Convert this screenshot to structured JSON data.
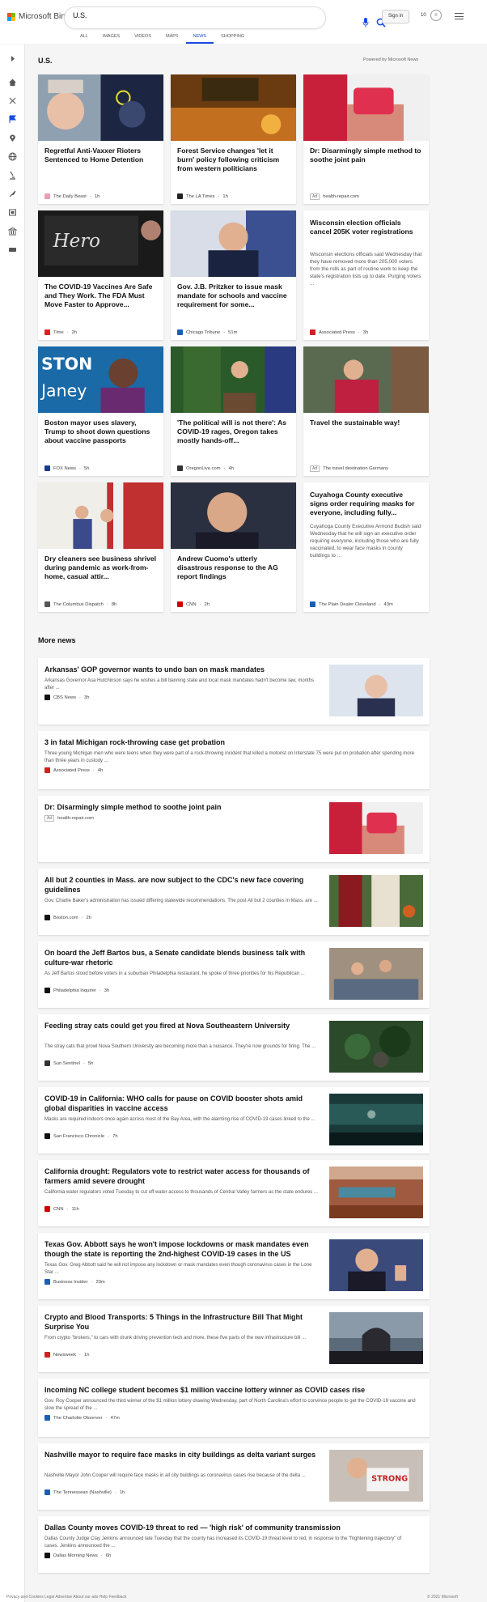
{
  "header": {
    "brand": "Microsoft Bing",
    "search_value": "U.S.",
    "signin_label": "Sign in",
    "points": "10",
    "scopes": [
      "ALL",
      "IMAGES",
      "VIDEOS",
      "MAPS",
      "NEWS",
      "SHOPPING"
    ],
    "active_scope": "NEWS"
  },
  "section": {
    "title": "U.S.",
    "powered_by": "Powered by Microsoft News"
  },
  "cards": [
    {
      "title": "Regretful Anti-Vaxxer Rioters Sentenced to Home Detention",
      "source": "The Daily Beast",
      "time": "1h",
      "favcolor": "#e8a0b0",
      "img": "riot"
    },
    {
      "title": "Forest Service changes 'let it burn' policy following criticism from western politicians",
      "source": "The LA Times",
      "time": "1h",
      "favcolor": "#222",
      "img": "fire"
    },
    {
      "title": "Dr: Disarmingly simple method to soothe joint pain",
      "source": "health-repair.com",
      "ad": "Ad",
      "img": "gummy"
    },
    {
      "title": "The COVID-19 Vaccines Are Safe and They Work. The FDA Must Move Faster to Approve...",
      "source": "Time",
      "time": "2h",
      "favcolor": "#e02020",
      "img": "vaccine"
    },
    {
      "title": "Gov. J.B. Pritzker to issue mask mandate for schools and vaccine requirement for some...",
      "source": "Chicago Tribune",
      "time": "51m",
      "favcolor": "#1a5fb4",
      "img": "pritzker"
    },
    {
      "title": "Wisconsin election officials cancel 205K voter registrations",
      "desc": "Wisconsin elections officials said Wednesday that they have removed more than 205,000 voters from the rolls as part of routine work to keep the state's registration lists up to date. Purging voters ...",
      "source": "Associated Press",
      "time": "3h",
      "favcolor": "#d02020",
      "img": ""
    },
    {
      "title": "Boston mayor uses slavery, Trump to shoot down questions about vaccine passports",
      "source": "FOX News",
      "time": "5h",
      "favcolor": "#1a3a8a",
      "img": "janey"
    },
    {
      "title": "'The political will is not there': As COVID-19 rages, Oregon takes mostly hands-off...",
      "source": "OregonLive.com",
      "time": "4h",
      "favcolor": "#333",
      "img": "oregon"
    },
    {
      "title": "Travel the sustainable way!",
      "source": "The travel destination Germany",
      "ad": "Ad",
      "img": "travel"
    },
    {
      "title": "Dry cleaners see business shrivel during pandemic as work-from-home, casual attir...",
      "source": "The Columbus Dispatch",
      "time": "8h",
      "favcolor": "#555",
      "img": "cleaners"
    },
    {
      "title": "Andrew Cuomo's utterly disastrous response to the AG report findings",
      "source": "CNN",
      "time": "2h",
      "favcolor": "#cc0000",
      "img": "cuomo"
    },
    {
      "title": "Cuyahoga County executive signs order requiring masks for everyone, including fully...",
      "desc": "Cuyahoga County Executive Armond Budish said Wednesday that he will sign an executive order requiring everyone, including those who are fully vaccinated, to wear face masks in county buildings to ...",
      "source": "The Plain Dealer Cleveland",
      "time": "43m",
      "favcolor": "#1a5fb4",
      "img": ""
    }
  ],
  "more_news": {
    "title": "More news",
    "items": [
      {
        "title": "Arkansas' GOP governor wants to undo ban on mask mandates",
        "desc": "Arkansas Governor Asa Hutchinson says he wishes a bill banning state and local mask mandates hadn't become law, months after ...",
        "source": "CBS News",
        "time": "3h",
        "favcolor": "#111",
        "img": "hutchinson"
      },
      {
        "title": "3 in fatal Michigan rock-throwing case get probation",
        "desc": "Three young Michigan men who were teens when they were part of a rock-throwing incident that killed a motorist on Interstate 75 were put on probation after spending more than three years in custody ...",
        "source": "Associated Press",
        "time": "4h",
        "favcolor": "#d02020",
        "img": ""
      },
      {
        "title": "Dr: Disarmingly simple method to soothe joint pain",
        "desc": "",
        "source": "health-repair.com",
        "ad": "Ad",
        "img": "gummy"
      },
      {
        "title": "All but 2 counties in Mass. are now subject to the CDC's new face covering guidelines",
        "desc": "Gov. Charlie Baker's administration has issued differing statewide recommendations. The post All but 2 counties in Mass. are ...",
        "source": "Boston.com",
        "time": "2h",
        "favcolor": "#111",
        "img": "mass"
      },
      {
        "title": "On board the Jeff Bartos bus, a Senate candidate blends business talk with culture-war rhetoric",
        "desc": "As Jeff Bartos stood before voters in a suburban Philadelphia restaurant, he spoke of three priorities for his Republican ...",
        "source": "Philadelphia Inquirer",
        "time": "3h",
        "favcolor": "#111",
        "img": "bartos"
      },
      {
        "title": "Feeding stray cats could get you fired at Nova Southeastern University",
        "desc": "The stray cats that prowl Nova Southern University are becoming more than a nuisance. They're now grounds for firing. The ...",
        "source": "Sun Sentinel",
        "time": "5h",
        "favcolor": "#333",
        "img": "cats"
      },
      {
        "title": "COVID-19 in California: WHO calls for pause on COVID booster shots amid global disparities in vaccine access",
        "desc": "Masks are required indoors once again across most of the Bay Area, with the alarming rise of COVID-19 cases linked to the ...",
        "source": "San Francisco Chronicle",
        "time": "7h",
        "favcolor": "#111",
        "img": "aquarium"
      },
      {
        "title": "California drought: Regulators vote to restrict water access for thousands of farmers amid severe drought",
        "desc": "California water regulators voted Tuesday to cut off water access to thousands of Central Valley farmers as the state endures ...",
        "source": "CNN",
        "time": "11h",
        "favcolor": "#cc0000",
        "img": "drought"
      },
      {
        "title": "Texas Gov. Abbott says he won't impose lockdowns or mask mandates even though the state is reporting the 2nd-highest COVID-19 cases in the US",
        "desc": "Texas Gov. Greg Abbott said he will not impose any lockdown or mask mandates even though coronavirus cases in the Lone Star ...",
        "source": "Business Insider",
        "time": "20m",
        "favcolor": "#1a5fb4",
        "img": "abbott"
      },
      {
        "title": "Crypto and Blood Transports: 5 Things in the Infrastructure Bill That Might Surprise You",
        "desc": "From crypto \"brokers,\" to cars with drunk driving prevention tech and more, these five parts of the new infrastructure bill ...",
        "source": "Newsweek",
        "time": "1h",
        "favcolor": "#d02020",
        "img": "capitol"
      },
      {
        "title": "Incoming NC college student becomes $1 million vaccine lottery winner as COVID cases rise",
        "desc": "Gov. Roy Cooper announced the third winner of the $1 million lottery drawing Wednesday, part of North Carolina's effort to convince people to get the COVID-19 vaccine and slow the spread of the ...",
        "source": "The Charlotte Observer",
        "time": "47m",
        "favcolor": "#1a5fb4",
        "img": ""
      },
      {
        "title": "Nashville mayor to require face masks in city buildings as delta variant surges",
        "desc": "Nashville Mayor John Cooper will require face masks in all city buildings as coronavirus cases rise because of the delta ...",
        "source": "The Tennessean (Nashville)",
        "time": "1h",
        "favcolor": "#1a5fb4",
        "img": "nashville"
      },
      {
        "title": "Dallas County moves COVID-19 threat to red — 'high risk' of community transmission",
        "desc": "Dallas County Judge Clay Jenkins announced late Tuesday that the county has increased its COVID-19 threat level to red, in response to the \"frightening trajectory\" of cases. Jenkins announced the ...",
        "source": "Dallas Morning News",
        "time": "6h",
        "favcolor": "#111",
        "img": ""
      }
    ]
  },
  "footer": {
    "left": "Privacy and Cookies   Legal   Advertise   About our ads   Help   Feedback",
    "right": "© 2021 Microsoft"
  }
}
